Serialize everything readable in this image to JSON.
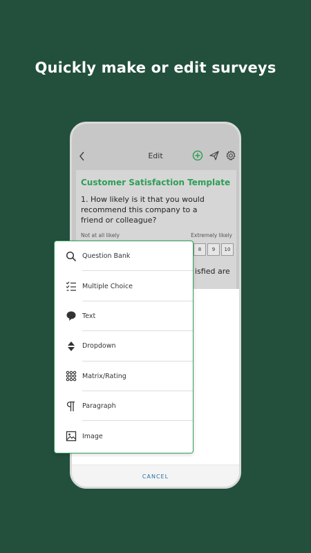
{
  "headline": "Quickly make or edit surveys",
  "appbar": {
    "title": "Edit"
  },
  "colors": {
    "background": "#22503d",
    "accent_green": "#2e9e57",
    "cancel_blue": "#2a6fa8"
  },
  "survey": {
    "title": "Customer Satisfaction Template",
    "question": "1. How likely is it that you would recommend this company to a friend or colleague?",
    "scale_low": "Not at all likely",
    "scale_high": "Extremely likely",
    "scale_values": [
      "8",
      "9",
      "10"
    ],
    "next_question_fragment": "isfied are"
  },
  "menu": {
    "items": [
      {
        "label": "Question Bank",
        "icon": "search-icon"
      },
      {
        "label": "Multiple Choice",
        "icon": "checklist-icon"
      },
      {
        "label": "Text",
        "icon": "speech-bubble-icon"
      },
      {
        "label": "Dropdown",
        "icon": "dropdown-arrows-icon"
      },
      {
        "label": "Matrix/Rating",
        "icon": "grid-dots-icon"
      },
      {
        "label": "Paragraph",
        "icon": "pilcrow-icon"
      },
      {
        "label": "Image",
        "icon": "image-icon"
      }
    ]
  },
  "footer": {
    "cancel_label": "CANCEL"
  }
}
